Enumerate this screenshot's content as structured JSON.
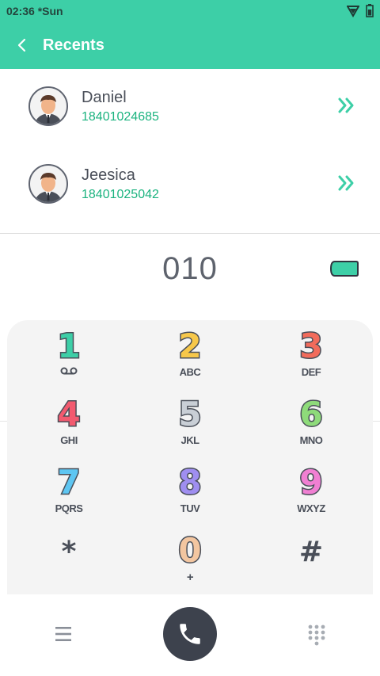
{
  "status_bar": {
    "time": "02:36 *Sun"
  },
  "app_bar": {
    "title": "Recents"
  },
  "recents": [
    {
      "name": "Daniel",
      "number": "18401024685"
    },
    {
      "name": "Jeesica",
      "number": "18401025042"
    }
  ],
  "dialer": {
    "entered_number": "010"
  },
  "keypad": [
    {
      "digit": "1",
      "letters": "",
      "color": "#3dcfa7",
      "sub_icon": "voicemail-icon"
    },
    {
      "digit": "2",
      "letters": "ABC",
      "color": "#f7c84a"
    },
    {
      "digit": "3",
      "letters": "DEF",
      "color": "#f26b5b"
    },
    {
      "digit": "4",
      "letters": "GHI",
      "color": "#f25a6f"
    },
    {
      "digit": "5",
      "letters": "JKL",
      "color": "#c9cfd6"
    },
    {
      "digit": "6",
      "letters": "MNO",
      "color": "#8edb7a"
    },
    {
      "digit": "7",
      "letters": "PQRS",
      "color": "#5ec6f2"
    },
    {
      "digit": "8",
      "letters": "TUV",
      "color": "#9f8ef0"
    },
    {
      "digit": "9",
      "letters": "WXYZ",
      "color": "#f07fd2"
    },
    {
      "digit": "*",
      "letters": ""
    },
    {
      "digit": "0",
      "letters": "+",
      "color": "#f3c6a0"
    },
    {
      "digit": "#",
      "letters": ""
    }
  ],
  "colors": {
    "accent": "#3dcfa7",
    "number_green": "#1bb37f",
    "dark": "#3d424d"
  },
  "icons": {
    "back": "chevron-left-icon",
    "detail": "double-chevron-right-icon",
    "delete": "backspace-icon",
    "menu": "menu-icon",
    "call": "phone-icon",
    "dialpad": "dialpad-icon"
  }
}
